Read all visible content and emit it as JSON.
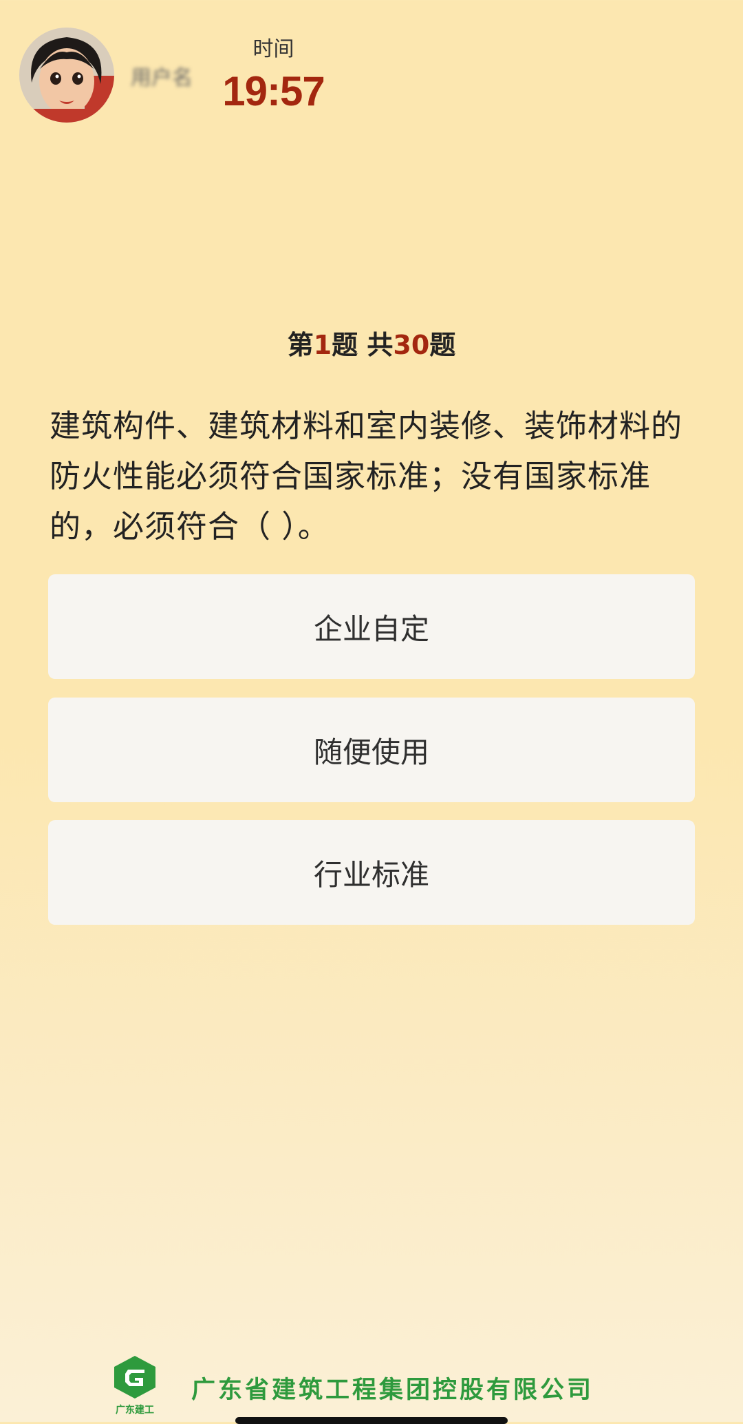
{
  "header": {
    "username": "用户名",
    "timer_label": "时间",
    "timer_value": "19:57"
  },
  "progress": {
    "prefix": "第",
    "current": "1",
    "middle": "题 共",
    "total": "30",
    "suffix": "题"
  },
  "question": {
    "text": "建筑构件、建筑材料和室内装修、装饰材料的防火性能必须符合国家标准；没有国家标准的，必须符合（ ）。"
  },
  "options": [
    {
      "label": "企业自定"
    },
    {
      "label": "随便使用"
    },
    {
      "label": "行业标准"
    }
  ],
  "footer": {
    "logo_text": "广东建工",
    "company_name": "广东省建筑工程集团控股有限公司"
  },
  "colors": {
    "background": "#fce7b0",
    "accent_red": "#a3270f",
    "option_bg": "#f7f5f1",
    "brand_green": "#2e9a3d"
  },
  "icons": {
    "avatar": "cartoon-avatar",
    "logo": "g-logo-icon"
  }
}
